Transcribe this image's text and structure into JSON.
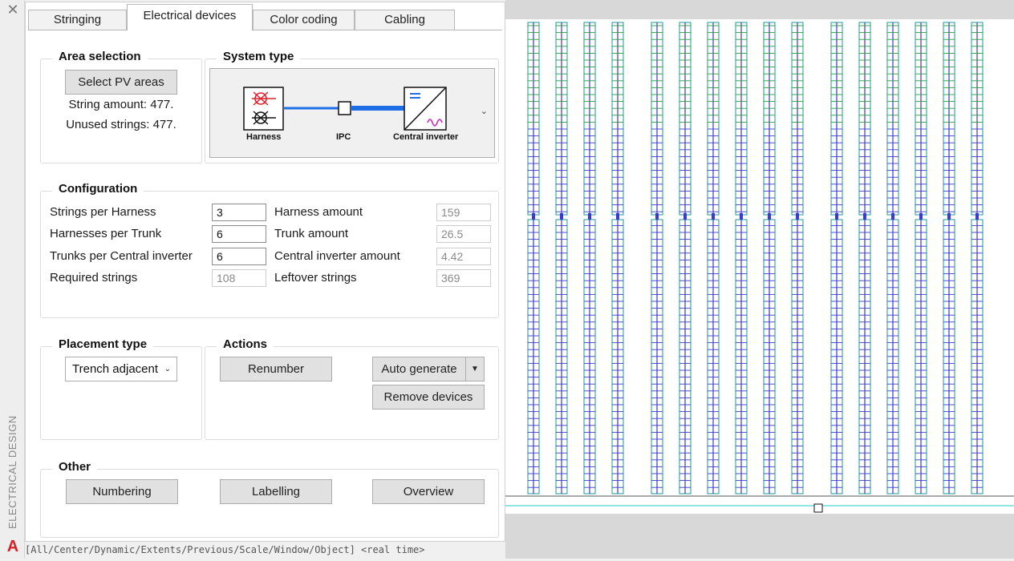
{
  "sidebar": {
    "title": "ELECTRICAL DESIGN",
    "close_icon": "close-icon",
    "logo_letter": "A"
  },
  "tabs": [
    {
      "label": "Stringing",
      "active": false
    },
    {
      "label": "Electrical devices",
      "active": true
    },
    {
      "label": "Color coding",
      "active": false
    },
    {
      "label": "Cabling",
      "active": false
    }
  ],
  "area_selection": {
    "title": "Area selection",
    "button": "Select PV areas",
    "string_amount": "String amount: 477.",
    "unused_strings": "Unused strings: 477."
  },
  "system_type": {
    "title": "System type",
    "labels": {
      "harness": "Harness",
      "ipc": "IPC",
      "inverter": "Central inverter"
    },
    "colors": {
      "line": "#1e6ee6",
      "harness_top": "#e0202a",
      "sine": "#cc22cc"
    }
  },
  "configuration": {
    "title": "Configuration",
    "rows": [
      {
        "label": "Strings per Harness",
        "value": "3",
        "r_label": "Harness amount",
        "r_value": "159"
      },
      {
        "label": "Harnesses per Trunk",
        "value": "6",
        "r_label": "Trunk amount",
        "r_value": "26.5"
      },
      {
        "label": "Trunks per Central inverter",
        "value": "6",
        "r_label": "Central inverter amount",
        "r_value": "4.42"
      },
      {
        "label": "Required strings",
        "value": "108",
        "r_label": "Leftover strings",
        "r_value": "369"
      }
    ]
  },
  "placement": {
    "title": "Placement type",
    "selected": "Trench adjacent"
  },
  "actions": {
    "title": "Actions",
    "renumber": "Renumber",
    "auto_generate": "Auto generate",
    "remove": "Remove devices"
  },
  "other": {
    "title": "Other",
    "numbering": "Numbering",
    "labelling": "Labelling",
    "overview": "Overview"
  },
  "drawing_colors": {
    "frame": "#1a9a9a",
    "blue": "#3a3ad0",
    "green": "#2a9a3a",
    "ground": "#d8d8d8",
    "cyan_line": "#22c8c8"
  },
  "command_line": "[All/Center/Dynamic/Extents/Previous/Scale/Window/Object] <real time>"
}
